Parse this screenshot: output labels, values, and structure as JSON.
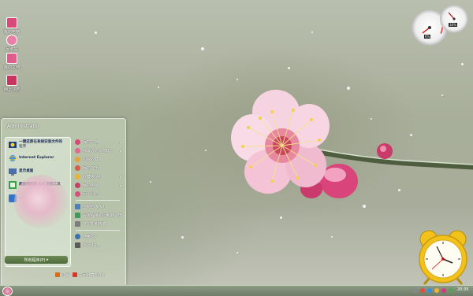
{
  "desktop": {
    "icons": [
      {
        "label": "我的电脑",
        "icon": "computer-icon",
        "color": "#d94a78"
      },
      {
        "label": "回收站",
        "icon": "recycle-bin-icon",
        "color": "#e87fa6"
      },
      {
        "label": "我的文档",
        "icon": "documents-icon",
        "color": "#e05c8a"
      },
      {
        "label": "网上邻居",
        "icon": "network-icon",
        "color": "#c8365f"
      }
    ]
  },
  "start_menu": {
    "user_name": "Administrator",
    "pinned": [
      {
        "line1": "一键还原在系统安装文件的",
        "line2": "程序",
        "icon": "restore-icon"
      },
      {
        "line1": "Internet Explorer",
        "line2": "",
        "icon": "ie-icon"
      },
      {
        "line1": "显示桌面",
        "line2": "",
        "icon": "desktop-icon"
      },
      {
        "line1": "超星阅览器 4.0 浏览工具",
        "line2": "",
        "icon": "reader-icon"
      },
      {
        "line1": "...",
        "line2": "",
        "icon": "app-icon"
      }
    ],
    "all_programs": "所有程序(P)",
    "places": [
      {
        "label": "我的文档",
        "arrow": true,
        "color": "#d94a78"
      },
      {
        "label": "我最近的文档(D)",
        "arrow": true,
        "color": "#e06a92"
      },
      {
        "label": "图片收藏",
        "arrow": false,
        "color": "#e3a53c"
      },
      {
        "label": "我的音乐",
        "arrow": false,
        "color": "#d85c4a"
      },
      {
        "label": "收藏夹(A)",
        "arrow": true,
        "color": "#e7b43a"
      },
      {
        "label": "我的电脑",
        "arrow": true,
        "color": "#c73f66"
      },
      {
        "label": "网上邻居",
        "arrow": false,
        "color": "#d5507e"
      }
    ],
    "settings": [
      {
        "label": "控制面板(C)",
        "color": "#4b7fbf"
      },
      {
        "label": "设定程序访问和默认值",
        "color": "#3d9a5a"
      },
      {
        "label": "打印机和传真",
        "color": "#7d7d7d"
      }
    ],
    "tools": [
      {
        "label": "搜索(S)",
        "color": "#3a6fb0"
      },
      {
        "label": "运行(R)...",
        "color": "#5a5a5a"
      }
    ],
    "logoff": "注销",
    "shutdown": "关闭计算机(U)"
  },
  "taskbar": {
    "clock": "20:35",
    "tray_colors": [
      "#888",
      "#e84a3c",
      "#3a8ee0",
      "#f0b23a",
      "#d03a7a",
      "#5aa05a"
    ]
  },
  "gadgets": {
    "cpu_meter": {
      "cpu_percent": "6%",
      "memory_percent": "38%"
    },
    "alarm_clock": {
      "color": "#f2c21a"
    }
  }
}
